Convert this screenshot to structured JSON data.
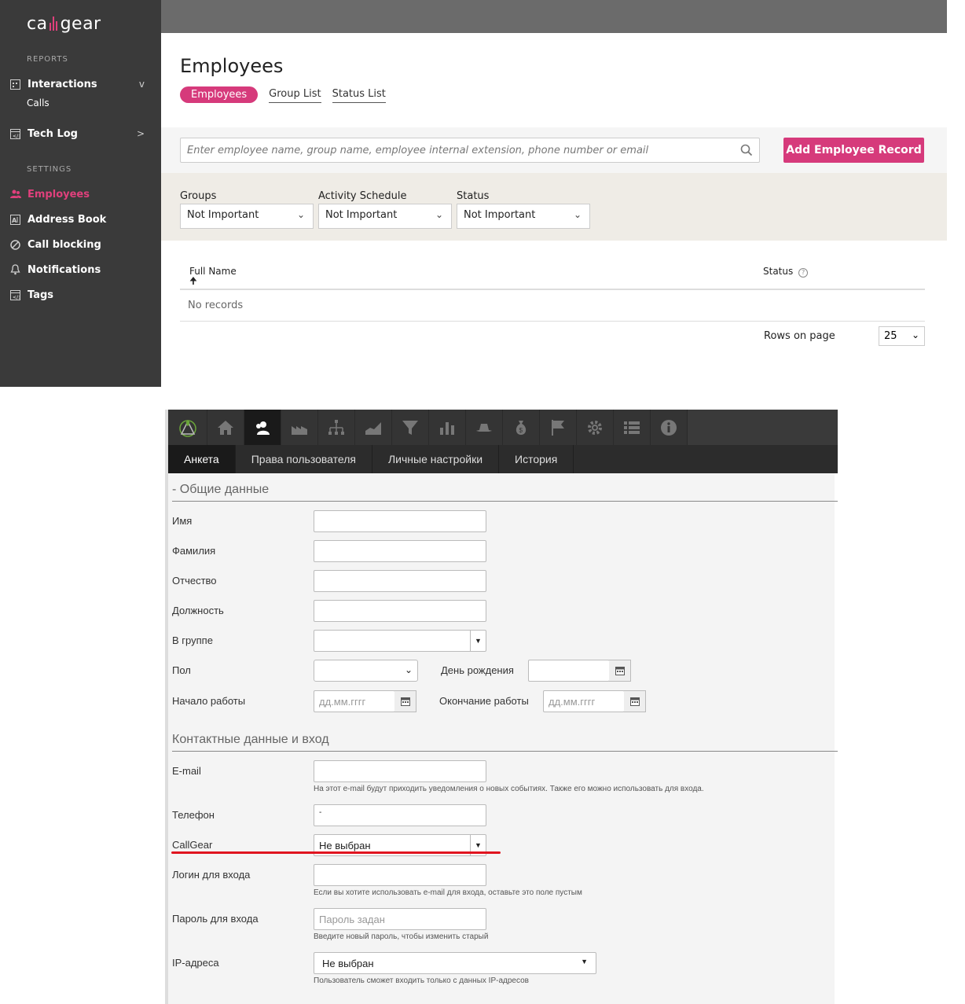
{
  "callgear": {
    "logo": {
      "left": "ca",
      "right": "gear"
    },
    "sidebar": {
      "reports_label": "REPORTS",
      "settings_label": "SETTINGS",
      "interactions": "Interactions",
      "interactions_arrow": "v",
      "calls": "Calls",
      "techlog": "Tech Log",
      "techlog_arrow": ">",
      "employees": "Employees",
      "address_book": "Address Book",
      "call_blocking": "Call blocking",
      "notifications": "Notifications",
      "tags": "Tags"
    },
    "page_title": "Employees",
    "tabs": [
      "Employees",
      "Group List",
      "Status List"
    ],
    "search_placeholder": "Enter employee name, group name, employee internal extension, phone number or email",
    "add_button": "Add Employee Record",
    "filters": [
      {
        "label": "Groups",
        "value": "Not Important"
      },
      {
        "label": "Activity Schedule",
        "value": "Not Important"
      },
      {
        "label": "Status",
        "value": "Not Important"
      }
    ],
    "table": {
      "col_fullname": "Full Name",
      "col_status": "Status",
      "empty": "No records",
      "rows_label": "Rows on page",
      "rows_value": "25"
    },
    "accent_color": "#d63a7b"
  },
  "crm": {
    "tabs": [
      "Анкета",
      "Права пользователя",
      "Личные настройки",
      "История"
    ],
    "section_general": "- Общие данные",
    "labels": {
      "name": "Имя",
      "surname": "Фамилия",
      "patronymic": "Отчество",
      "position": "Должность",
      "group": "В группе",
      "gender": "Пол",
      "birthday": "День рождения",
      "work_start": "Начало работы",
      "work_end": "Окончание работы",
      "email": "E-mail",
      "phone": "Телефон",
      "callgear": "CallGear",
      "login": "Логин для входа",
      "password": "Пароль для входа",
      "ip": "IP-адреса"
    },
    "date_placeholder": "дд.мм.гггг",
    "section_contacts": "Контактные данные и вход",
    "phone_value": "-",
    "callgear_value": "Не выбран",
    "password_placeholder": "Пароль задан",
    "ip_value": "Не выбран",
    "help": {
      "email": "На этот e-mail будут приходить уведомления о новых событиях. Также его можно использовать для входа.",
      "login": "Если вы хотите использовать e-mail для входа, оставьте это поле пустым",
      "password": "Введите новый пароль, чтобы изменить старый",
      "ip": "Пользователь сможет входить только с данных IP-адресов"
    },
    "highlight_color": "#e0141f"
  }
}
